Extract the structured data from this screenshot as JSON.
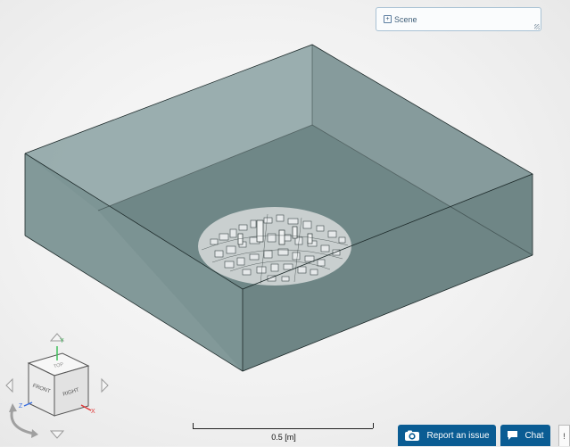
{
  "scene_panel": {
    "label": "Scene",
    "expander": "+"
  },
  "scale_bar": {
    "label": "0.5 [m]"
  },
  "view_cube": {
    "top_label": "TOP",
    "front_label": "FRONT",
    "right_label": "RIGHT",
    "axes": {
      "x": "X",
      "y": "Y",
      "z": "Z"
    },
    "axis_colors": {
      "x": "#e03a3a",
      "y": "#3fbf5a",
      "z": "#3a6fe0"
    }
  },
  "buttons": {
    "report": "Report an issue",
    "chat": "Chat",
    "extra": "!"
  },
  "colors": {
    "accent": "#0a5c93",
    "domain_top": "#7e999b",
    "domain_front": "#78908f",
    "domain_right": "#6b8180"
  }
}
